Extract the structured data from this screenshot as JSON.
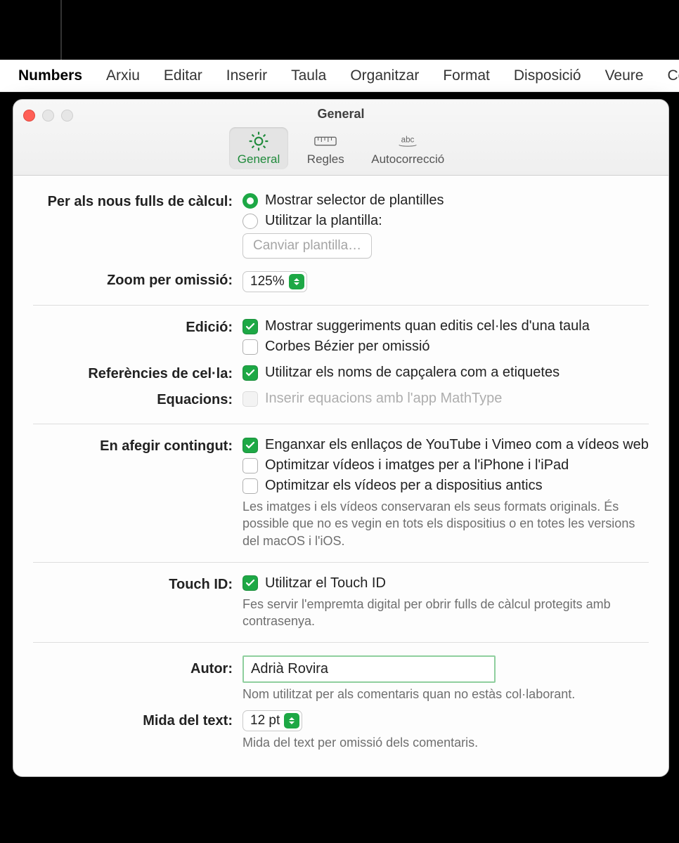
{
  "menubar": {
    "items": [
      "Numbers",
      "Arxiu",
      "Editar",
      "Inserir",
      "Taula",
      "Organitzar",
      "Format",
      "Disposició",
      "Veure",
      "Comp"
    ],
    "active_index": 0
  },
  "window": {
    "title": "General",
    "tabs": {
      "general": "General",
      "rulers": "Regles",
      "autocorrect": "Autocorrecció"
    }
  },
  "sections": {
    "new_sheets": {
      "label": "Per als nous fulls de càlcul:",
      "opt_template_selector": "Mostrar selector de plantilles",
      "opt_use_template": "Utilitzar la plantilla:",
      "change_template_btn": "Canviar plantilla…"
    },
    "zoom": {
      "label": "Zoom per omissió:",
      "value": "125%"
    },
    "editing": {
      "label": "Edició:",
      "show_suggestions": "Mostrar suggeriments quan editis cel·les d'una taula",
      "bezier": "Corbes Bézier per omissió"
    },
    "cell_refs": {
      "label": "Referències de cel·la:",
      "use_header_names": "Utilitzar els noms de capçalera com a etiquetes"
    },
    "equations": {
      "label": "Equacions:",
      "mathtype": "Inserir equacions amb l'app MathType"
    },
    "add_content": {
      "label": "En afegir contingut:",
      "paste_links": "Enganxar els enllaços de YouTube i Vimeo com a vídeos web",
      "optimize_iphone": "Optimitzar vídeos i imatges per a l'iPhone i l'iPad",
      "optimize_old": "Optimitzar els vídeos per a dispositius antics",
      "desc": "Les imatges i els vídeos conservaran els seus formats originals. És possible que no es vegin en tots els dispositius o en totes les versions del macOS i l'iOS."
    },
    "touchid": {
      "label": "Touch ID:",
      "use_touchid": "Utilitzar el Touch ID",
      "desc": "Fes servir l'empremta digital per obrir fulls de càlcul protegits amb contrasenya."
    },
    "author": {
      "label": "Autor:",
      "value": "Adrià Rovira",
      "desc": "Nom utilitzat per als comentaris quan no estàs col·laborant."
    },
    "text_size": {
      "label": "Mida del text:",
      "value": "12 pt",
      "desc": "Mida del text per omissió dels comentaris."
    }
  }
}
